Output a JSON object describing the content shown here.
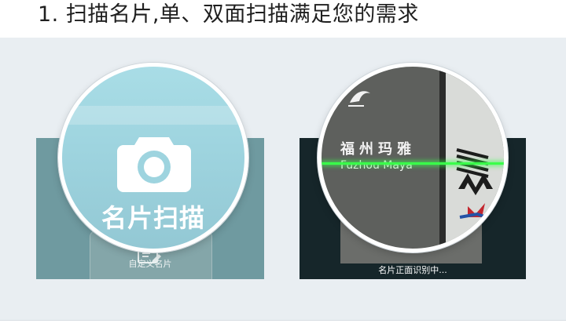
{
  "heading": "1. 扫描名片,单、双面扫描满足您的需求",
  "left_panel": {
    "magnifier_label": "名片扫描",
    "tile_label": "自定义名片",
    "camera_icon": "camera-icon"
  },
  "right_panel": {
    "status_text": "名片正面识别中...",
    "card_company_cn": "福州玛雅",
    "card_company_en": "Fuzhou Maya",
    "scan_line_color": "#39ff4a"
  },
  "colors": {
    "panel_bg": "#e9eef2",
    "magnifier_left_bg": "#a9dde6",
    "scan_line": "#39ff4a"
  }
}
